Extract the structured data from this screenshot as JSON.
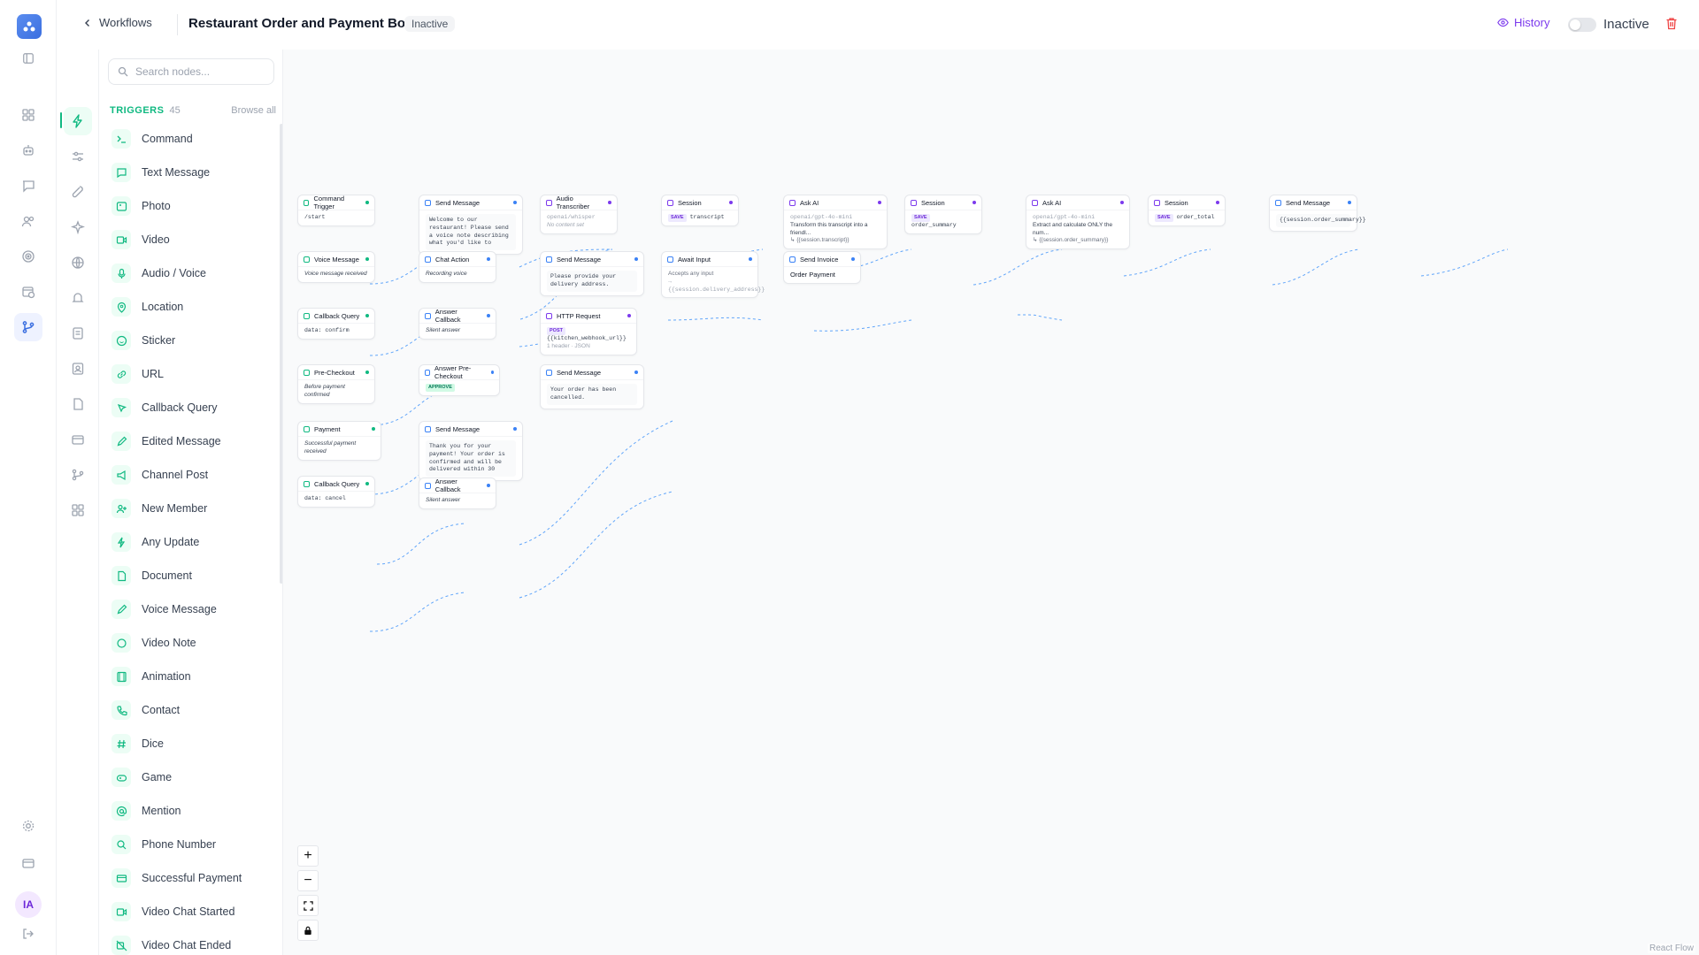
{
  "header": {
    "back_label": "Workflows",
    "title": "Restaurant Order and Payment Bot",
    "status_pill": "Inactive",
    "history_label": "History",
    "toggle_label": "Inactive"
  },
  "user": {
    "initials": "IA"
  },
  "palette": {
    "search_placeholder": "Search nodes...",
    "section_name": "TRIGGERS",
    "section_count": "45",
    "browse_label": "Browse all",
    "items": [
      {
        "label": "Command",
        "icon": "terminal-icon"
      },
      {
        "label": "Text Message",
        "icon": "message-icon"
      },
      {
        "label": "Photo",
        "icon": "image-icon"
      },
      {
        "label": "Video",
        "icon": "video-icon"
      },
      {
        "label": "Audio / Voice",
        "icon": "mic-icon"
      },
      {
        "label": "Location",
        "icon": "map-pin-icon"
      },
      {
        "label": "Sticker",
        "icon": "smile-icon"
      },
      {
        "label": "URL",
        "icon": "link-icon"
      },
      {
        "label": "Callback Query",
        "icon": "pointer-icon"
      },
      {
        "label": "Edited Message",
        "icon": "pencil-icon"
      },
      {
        "label": "Channel Post",
        "icon": "megaphone-icon"
      },
      {
        "label": "New Member",
        "icon": "user-plus-icon"
      },
      {
        "label": "Any Update",
        "icon": "zap-icon"
      },
      {
        "label": "Document",
        "icon": "file-icon"
      },
      {
        "label": "Voice Message",
        "icon": "wave-icon"
      },
      {
        "label": "Video Note",
        "icon": "circle-icon"
      },
      {
        "label": "Animation",
        "icon": "film-icon"
      },
      {
        "label": "Contact",
        "icon": "phone-icon"
      },
      {
        "label": "Dice",
        "icon": "hash-icon"
      },
      {
        "label": "Game",
        "icon": "gamepad-icon"
      },
      {
        "label": "Mention",
        "icon": "at-icon"
      },
      {
        "label": "Phone Number",
        "icon": "search-icon"
      },
      {
        "label": "Successful Payment",
        "icon": "card-icon"
      },
      {
        "label": "Video Chat Started",
        "icon": "video-icon"
      },
      {
        "label": "Video Chat Ended",
        "icon": "video-off-icon"
      }
    ]
  },
  "nodes": {
    "n1": {
      "title": "Command Trigger",
      "body": "/start"
    },
    "n2": {
      "title": "Voice Message",
      "body": "Voice message received"
    },
    "n3": {
      "title": "Callback Query",
      "body": "data: confirm"
    },
    "n4": {
      "title": "Pre-Checkout",
      "body": "Before payment confirmed"
    },
    "n5": {
      "title": "Payment",
      "body": "Successful payment received"
    },
    "n6": {
      "title": "Callback Query",
      "body": "data: cancel"
    },
    "n7": {
      "title": "Send Message",
      "body": "Welcome to our restaurant! Please send a voice note describing what you'd like to"
    },
    "n8": {
      "title": "Chat Action",
      "body": "Recording voice"
    },
    "n9": {
      "title": "Answer Callback",
      "body": "Silent answer"
    },
    "n10": {
      "title": "Answer Pre-Checkout",
      "tag": "APPROVE"
    },
    "n11": {
      "title": "Send Message",
      "body": "Thank you for your payment! Your order is confirmed and will be delivered within 30"
    },
    "n12": {
      "title": "Answer Callback",
      "body": "Silent answer"
    },
    "n13": {
      "title": "Audio Transcriber",
      "model": "openai/whisper",
      "body": "No content set"
    },
    "n14": {
      "title": "Send Message",
      "body": "Please provide your delivery address."
    },
    "n15": {
      "title": "HTTP Request",
      "tag": "POST",
      "url": "{{kitchen_webhook_url}}",
      "meta": "1 header · JSON"
    },
    "n16": {
      "title": "Send Message",
      "body": "Your order has been cancelled."
    },
    "n17": {
      "title": "Session",
      "tag": "SAVE",
      "body": "transcript"
    },
    "n18": {
      "title": "Await Input",
      "body": "Accepts any input",
      "var": "→ {{session.delivery_address}}"
    },
    "n19": {
      "title": "Ask AI",
      "model": "openai/gpt-4o-mini",
      "body": "Transform this transcript into a friendl...",
      "var": "↳ {{session.transcript}}"
    },
    "n20": {
      "title": "Send Invoice",
      "body": "Order Payment"
    },
    "n21": {
      "title": "Session",
      "tag": "SAVE",
      "body": "order_summary"
    },
    "n22": {
      "title": "Ask AI",
      "model": "openai/gpt-4o-mini",
      "body": "Extract and calculate ONLY the num...",
      "var": "↳ {{session.order_summary}}"
    },
    "n23": {
      "title": "Session",
      "tag": "SAVE",
      "body": "order_total"
    },
    "n24": {
      "title": "Send Message",
      "body": "{{session.order_summary}}"
    }
  },
  "canvas": {
    "attribution": "React Flow",
    "zoom_in": "+",
    "zoom_out": "−"
  },
  "colors": {
    "trigger": "#10b981",
    "action": "#3b82f6",
    "ai": "#7c3aed",
    "edge": "#60a5fa"
  }
}
